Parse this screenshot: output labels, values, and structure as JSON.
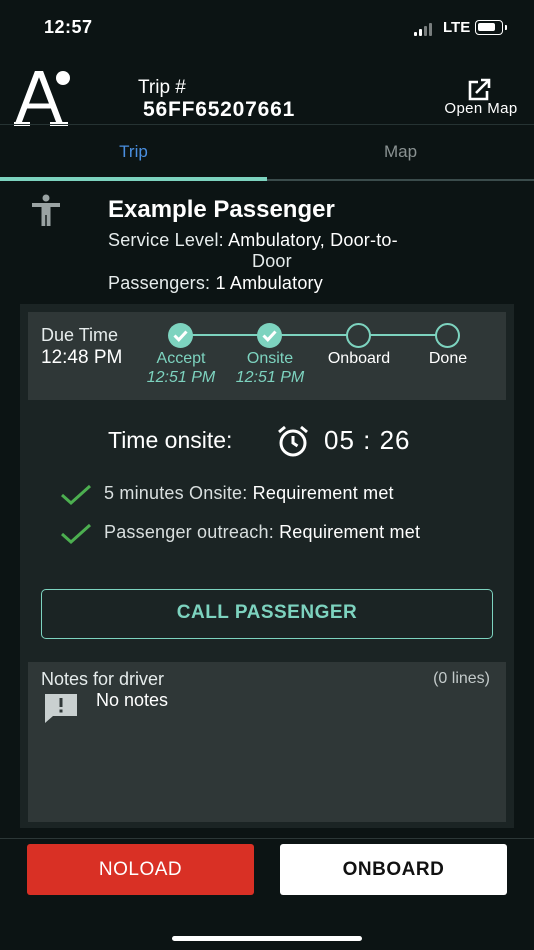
{
  "status_bar": {
    "time": "12:57",
    "network": "LTE"
  },
  "header": {
    "trip_label": "Trip #",
    "trip_id": "56FF65207661",
    "open_map_label": "Open Map"
  },
  "tabs": [
    {
      "label": "Trip",
      "active": true
    },
    {
      "label": "Map",
      "active": false
    }
  ],
  "passenger": {
    "name": "Example Passenger",
    "service_level_label": "Service Level:",
    "service_level_value_1": "Ambulatory, Door-to-",
    "service_level_value_2": "Door",
    "passengers_label": "Passengers:",
    "passengers_value": "1 Ambulatory"
  },
  "progress": {
    "due_label": "Due Time",
    "due_time": "12:48 PM",
    "steps": [
      {
        "label": "Accept",
        "time": "12:51 PM",
        "done": true
      },
      {
        "label": "Onsite",
        "time": "12:51 PM",
        "done": true
      },
      {
        "label": "Onboard",
        "done": false
      },
      {
        "label": "Done",
        "done": false
      }
    ]
  },
  "onsite": {
    "label": "Time onsite:",
    "timer": "05 : 26"
  },
  "requirements": [
    {
      "label": "5 minutes Onsite:",
      "status": "Requirement met"
    },
    {
      "label": "Passenger outreach:",
      "status": "Requirement met"
    }
  ],
  "call_button": "CALL PASSENGER",
  "notes": {
    "title": "Notes for driver",
    "count": "(0 lines)",
    "text": "No notes"
  },
  "actions": {
    "noload": "NOLOAD",
    "onboard": "ONBOARD"
  },
  "colors": {
    "accent": "#7dd3bf",
    "tab_active": "#4a8fe0",
    "danger": "#d93025",
    "background": "#0c1414"
  }
}
